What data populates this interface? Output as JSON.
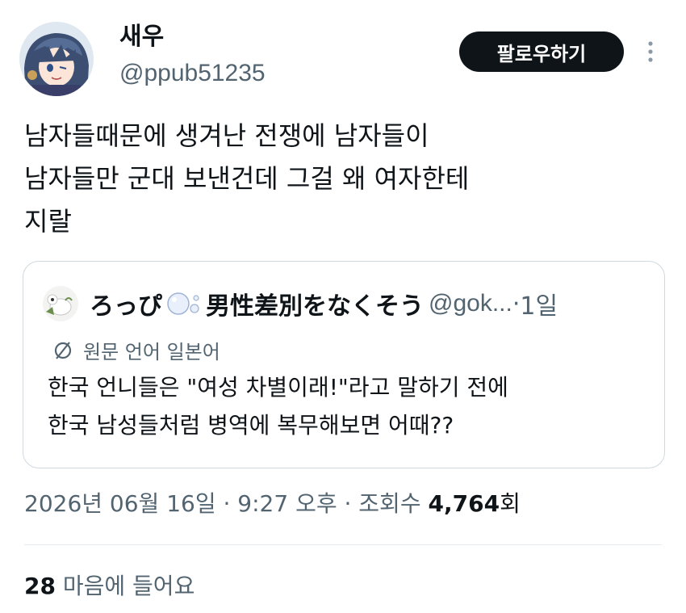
{
  "author": {
    "name": "새우",
    "handle": "@ppub51235"
  },
  "follow_button": {
    "label": "팔로우하기"
  },
  "tweet": {
    "lines": [
      "남자들때문에 생겨난 전쟁에 남자들이",
      "남자들만 군대 보낸건데 그걸 왜 여자한테",
      "지랄"
    ]
  },
  "quote": {
    "name_part1": "ろっぴ",
    "name_part2": "男性差別をなくそう",
    "handle": "@gok...",
    "separator": " · ",
    "date": "1일",
    "language_note": "원문 언어 일본어",
    "lines": [
      "한국 언니들은 \"여성 차별이래!\"라고 말하기 전에",
      "한국 남성들처럼 병역에 복무해보면 어때??"
    ]
  },
  "meta": {
    "datetime": "2026년 06월 16일 · 9:27 오후 · 조회수 ",
    "views": "4,764",
    "views_unit": "회"
  },
  "likes": {
    "count": "28",
    "label": " 마음에 들어요"
  },
  "colors": {
    "text": "#0f1419",
    "secondary": "#536471",
    "follow_bg": "#0f1419",
    "border": "#cfd9de"
  }
}
